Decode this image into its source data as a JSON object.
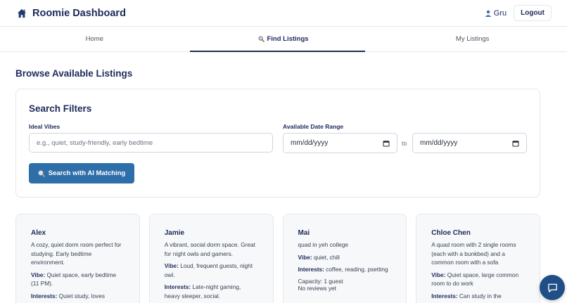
{
  "header": {
    "title": "Roomie Dashboard",
    "user_name": "Gru",
    "logout_label": "Logout",
    "icons": {
      "brand": "home-icon",
      "user": "user-icon"
    }
  },
  "tabs": [
    {
      "label": "Home",
      "active": false
    },
    {
      "label": "Find Listings",
      "active": true,
      "icon": "magnifier-icon"
    },
    {
      "label": "My Listings",
      "active": false
    }
  ],
  "page_title": "Browse Available Listings",
  "filters": {
    "title": "Search Filters",
    "vibes_label": "Ideal Vibes",
    "vibes_placeholder": "e.g., quiet, study-friendly, early bedtime",
    "vibes_value": "",
    "date_label": "Available Date Range",
    "date_from": "mm/dd/yyyy",
    "date_to": "mm/dd/yyyy",
    "to_text": "to",
    "search_label": "Search with AI Matching"
  },
  "listings": [
    {
      "name": "Alex",
      "description": "A cozy, quiet dorm room perfect for studying. Early bedtime environment.",
      "vibe_label": "Vibe:",
      "vibe": "Quiet space, early bedtime (11 PM).",
      "interests_label": "Interests:",
      "interests": "Quiet study, loves"
    },
    {
      "name": "Jamie",
      "description": "A vibrant, social dorm space. Great for night owls and gamers.",
      "vibe_label": "Vibe:",
      "vibe": "Loud, frequent guests, night owl.",
      "interests_label": "Interests:",
      "interests": "Late-night gaming, heavy sleeper, social."
    },
    {
      "name": "Mai",
      "description": "quad in yeh college",
      "vibe_label": "Vibe:",
      "vibe": "quiet, chill",
      "interests_label": "Interests:",
      "interests": "coffee, reading, psetting",
      "capacity": "Capacity: 1 guest",
      "reviews": "No reviews yet"
    },
    {
      "name": "Chloe Chen",
      "description": "A quad room with 2 single rooms (each with a bunkbed) and a common room with a sofa",
      "vibe_label": "Vibe:",
      "vibe": "Quiet space, large common room to do work",
      "interests_label": "Interests:",
      "interests": "Can study in the"
    }
  ],
  "chat_button": {
    "icon": "chat-icon"
  },
  "colors": {
    "primary": "#1e2a5a",
    "button": "#2f6fa9",
    "fab": "#1f4f86"
  }
}
